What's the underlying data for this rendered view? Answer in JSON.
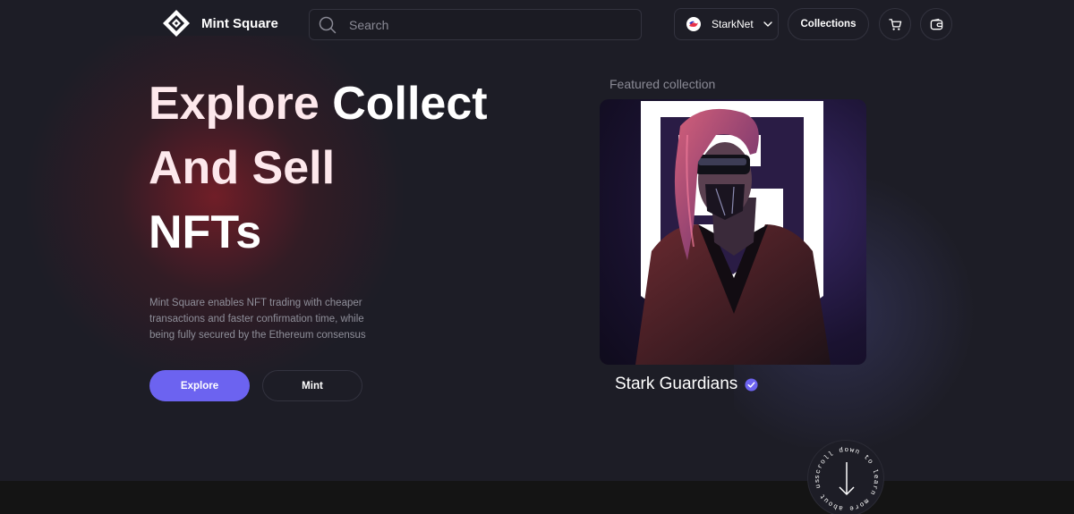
{
  "header": {
    "brand": "Mint Square",
    "search_placeholder": "Search",
    "network": "StarkNet",
    "collections_label": "Collections"
  },
  "hero": {
    "title_line1_a": "Explore",
    "title_line1_b": "Collect",
    "title_line2": "And Sell",
    "title_line3": "NFTs",
    "description": "Mint Square enables NFT trading with cheaper transactions and faster confirmation time, while being fully secured by the Ethereum consensus",
    "explore_label": "Explore",
    "mint_label": "Mint"
  },
  "featured": {
    "label": "Featured collection",
    "name": "Stark Guardians"
  },
  "scroll_badge": {
    "text": "scroll down to learn more about us"
  },
  "colors": {
    "background": "#1d1d26",
    "accent": "#6c63f0",
    "verified": "#6c63f0"
  }
}
